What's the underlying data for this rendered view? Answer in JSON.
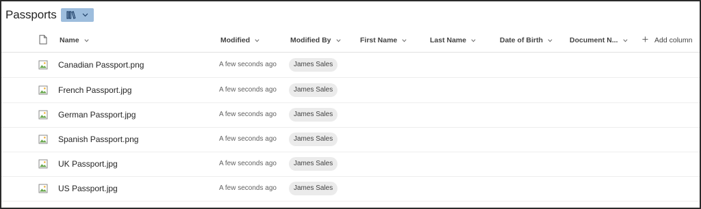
{
  "library": {
    "title": "Passports"
  },
  "columns": {
    "name": "Name",
    "modified": "Modified",
    "modified_by": "Modified By",
    "first_name": "First Name",
    "last_name": "Last Name",
    "date_of_birth": "Date of Birth",
    "document_number": "Document N...",
    "add_column": "Add column"
  },
  "rows": [
    {
      "name": "Canadian Passport.png",
      "modified": "A few seconds ago",
      "modified_by": "James Sales"
    },
    {
      "name": "French Passport.jpg",
      "modified": "A few seconds ago",
      "modified_by": "James Sales"
    },
    {
      "name": "German Passport.jpg",
      "modified": "A few seconds ago",
      "modified_by": "James Sales"
    },
    {
      "name": "Spanish Passport.png",
      "modified": "A few seconds ago",
      "modified_by": "James Sales"
    },
    {
      "name": "UK Passport.jpg",
      "modified": "A few seconds ago",
      "modified_by": "James Sales"
    },
    {
      "name": "US Passport.jpg",
      "modified": "A few seconds ago",
      "modified_by": "James Sales"
    }
  ],
  "colors": {
    "view_switcher_bg": "#9dbddd",
    "chip_bg": "#ebebeb"
  },
  "icons": {
    "view_switcher": "library-books-icon",
    "file": "image-file-icon",
    "file_type_header": "document-icon",
    "add_column": "plus-icon",
    "sort": "chevron-down-icon"
  }
}
